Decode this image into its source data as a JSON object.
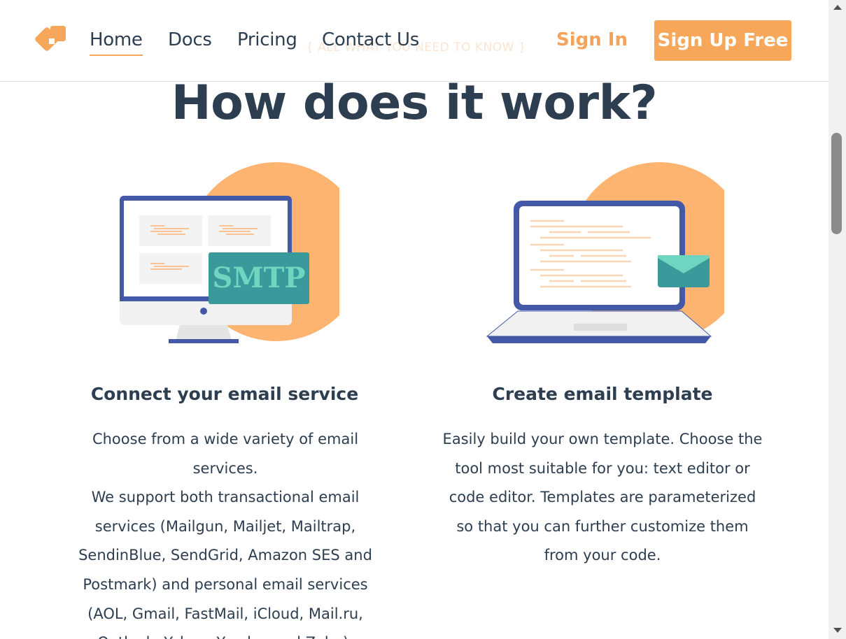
{
  "header": {
    "nav": {
      "home": "Home",
      "docs": "Docs",
      "pricing": "Pricing",
      "contact": "Contact Us"
    },
    "sign_in": "Sign In",
    "sign_up": "Sign Up Free"
  },
  "section": {
    "eyebrow": "{ ALL WHAT YOU NEED TO KNOW }",
    "title": "How does it work?"
  },
  "cards": [
    {
      "illustration_label": "SMTP",
      "title": "Connect your email service",
      "text": "Choose from a wide variety of email services.\nWe support both transactional email services (Mailgun, Mailjet, Mailtrap, SendinBlue, SendGrid, Amazon SES and Postmark) and personal email services (AOL, Gmail, FastMail, iCloud, Mail.ru, Outlook, Yahoo, Yandex and Zoho)."
    },
    {
      "title": "Create email template",
      "text": "Easily build your own template. Choose the tool most suitable for you: text editor or code editor. Templates are parameterized so that you can further customize them from your code."
    }
  ],
  "colors": {
    "accent": "#f7a75a",
    "heading": "#2d3e50",
    "monitor_frame": "#4458a8",
    "teal": "#3a9a9b",
    "mint": "#6ed6c0"
  },
  "icons": {
    "logo": "app-logo-icon",
    "scroll_up": "arrow-up-icon",
    "scroll_down": "arrow-down-icon"
  }
}
